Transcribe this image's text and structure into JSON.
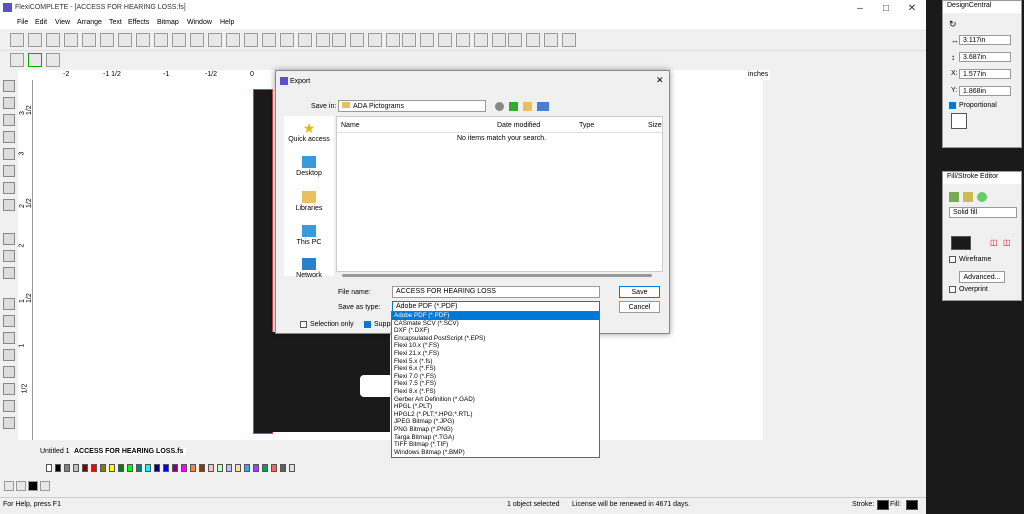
{
  "app": {
    "title": "FlexiCOMPLETE - [ACCESS FOR HEARING LOSS.fs]",
    "menus": [
      "File",
      "Edit",
      "View",
      "Arrange",
      "Text",
      "Effects",
      "Bitmap",
      "Window",
      "Help"
    ],
    "ruler_labels": [
      "-2",
      "-1 1/2",
      "-1",
      "-1/2",
      "0",
      "inches"
    ],
    "vruler_labels": [
      "3 1/2",
      "3",
      "2 1/2",
      "2",
      "1 1/2",
      "1",
      "1/2"
    ],
    "doc_tabs": [
      "Untitled 1",
      "ACCESS FOR HEARING LOSS.fs"
    ],
    "status": {
      "help": "For Help, press F1",
      "selection": "1 object selected",
      "license": "License will be renewed in 4671 days.",
      "stroke": "Stroke:",
      "fill": "Fill:"
    }
  },
  "design_central": {
    "title": "DesignCentral",
    "width": "3.117in",
    "height": "3.687in",
    "x_label": "X:",
    "x": "1.577in",
    "y_label": "Y:",
    "y": "1.868in",
    "proportional": "Proportional"
  },
  "fill_stroke": {
    "title": "Fill/Stroke Editor",
    "fill_type": "Solid fill",
    "wireframe": "Wireframe",
    "advanced": "Advanced...",
    "overprint": "Overprint"
  },
  "export_dialog": {
    "title": "Export",
    "save_in_label": "Save in:",
    "save_in_value": "ADA Pictograms",
    "nav": [
      "Quick access",
      "Desktop",
      "Libraries",
      "This PC",
      "Network"
    ],
    "columns": [
      "Name",
      "Date modified",
      "Type",
      "Size"
    ],
    "empty_message": "No items match your search.",
    "file_name_label": "File name:",
    "file_name_value": "ACCESS FOR HEARING LOSS",
    "save_as_type_label": "Save as type:",
    "save_as_type_value": "Adobe PDF (*.PDF)",
    "save_button": "Save",
    "cancel_button": "Cancel",
    "selection_only": "Selection only",
    "suppress": "Suppre",
    "type_options": [
      "Adobe PDF (*.PDF)",
      "CASmate SCV (*.SCV)",
      "DXF (*.DXF)",
      "Encapsulated PostScript (*.EPS)",
      "Flexi 10.x (*.FS)",
      "Flexi 21.x (*.FS)",
      "Flexi 5.x (*.fs)",
      "Flexi 6.x (*.FS)",
      "Flexi 7.0 (*.FS)",
      "Flexi 7.5 (*.FS)",
      "Flexi 8.x (*.FS)",
      "Gerber Art Definition (*.GAD)",
      "HPGL (*.PLT)",
      "HPGL2 (*.PLT;*.HPG;*.RTL)",
      "JPEG Bitmap (*.JPG)",
      "PNG Bitmap (*.PNG)",
      "Targa Bitmap (*.TGA)",
      "TIFF Bitmap (*.TIF)",
      "Windows Bitmap (*.BMP)"
    ]
  },
  "colors": {
    "accent": "#0078d7",
    "palette": [
      "#ffffff",
      "#000000",
      "#808080",
      "#c0c0c0",
      "#800000",
      "#ff0000",
      "#808000",
      "#ffff00",
      "#008000",
      "#00ff00",
      "#008080",
      "#00ffff",
      "#000080",
      "#0000ff",
      "#800080",
      "#ff00ff",
      "#ff8040",
      "#804000",
      "#ffc0c0",
      "#c0ffc0",
      "#c0c0ff",
      "#ffe0a0",
      "#40a0ff",
      "#a040ff",
      "#00a060",
      "#ff6060",
      "#606060",
      "#e0e0e0"
    ]
  }
}
